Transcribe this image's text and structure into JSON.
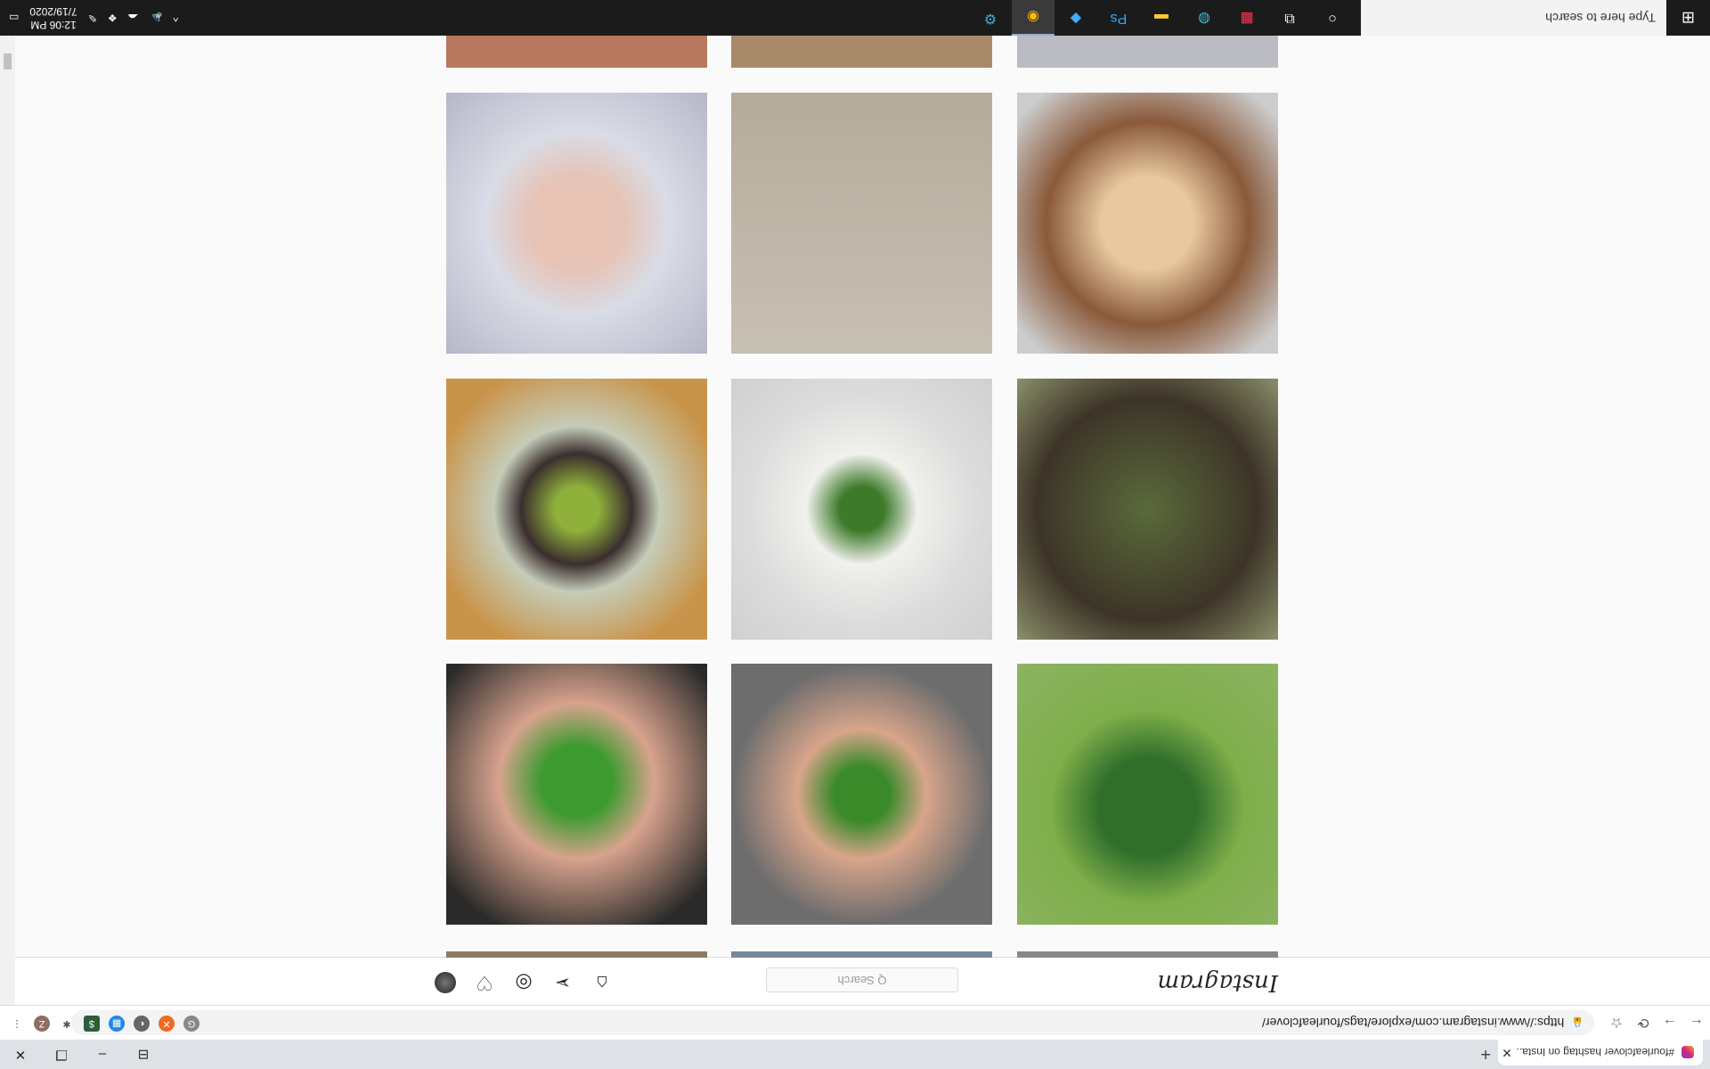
{
  "browser": {
    "tab_title": "#fourleafclover hashtag on Insta...",
    "tab_close": "✕",
    "new_tab": "+",
    "window_controls": [
      "⊟",
      "–",
      "❐",
      "✕"
    ],
    "url": "https://www.instagram.com/explore/tags/fourleafclover/",
    "nav": [
      "←",
      "→",
      "⟳",
      "☆"
    ],
    "extensions": [
      "G",
      "✕",
      "◐",
      "▦",
      "$",
      "✱",
      "Z",
      "⋮"
    ]
  },
  "instagram": {
    "logo": "Instagram",
    "search_placeholder": "Q  Search",
    "nav_icons": [
      "home-icon",
      "direct-icon",
      "explore-icon",
      "activity-icon",
      "profile-avatar"
    ]
  },
  "taskbar": {
    "start": "⊞",
    "search_placeholder": "Type here to search",
    "time": "12:06 PM",
    "date": "7/19/2020"
  }
}
